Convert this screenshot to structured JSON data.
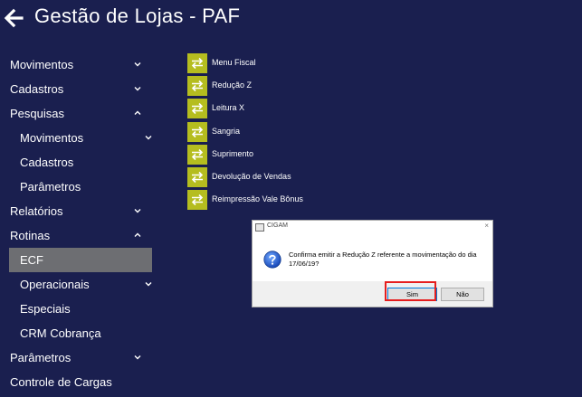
{
  "header": {
    "title": "Gestão de Lojas - PAF",
    "back_icon": "back-arrow-icon"
  },
  "sidebar": {
    "items": [
      {
        "label": "Movimentos",
        "level": 1,
        "chevron": "down"
      },
      {
        "label": "Cadastros",
        "level": 1,
        "chevron": "down"
      },
      {
        "label": "Pesquisas",
        "level": 1,
        "chevron": "up"
      },
      {
        "label": "Movimentos",
        "level": 2,
        "chevron": "down"
      },
      {
        "label": "Cadastros",
        "level": 2,
        "chevron": ""
      },
      {
        "label": "Parâmetros",
        "level": 2,
        "chevron": ""
      },
      {
        "label": "Relatórios",
        "level": 1,
        "chevron": "down"
      },
      {
        "label": "Rotinas",
        "level": 1,
        "chevron": "up"
      },
      {
        "label": "ECF",
        "level": 2,
        "chevron": "",
        "active": true
      },
      {
        "label": "Operacionais",
        "level": 2,
        "chevron": "down"
      },
      {
        "label": "Especiais",
        "level": 2,
        "chevron": ""
      },
      {
        "label": "CRM Cobrança",
        "level": 2,
        "chevron": ""
      },
      {
        "label": "Parâmetros",
        "level": 1,
        "chevron": "down"
      },
      {
        "label": "Controle de Cargas",
        "level": 1,
        "chevron": ""
      }
    ]
  },
  "actions": {
    "icon": "swap-arrows-icon",
    "items": [
      {
        "label": "Menu Fiscal"
      },
      {
        "label": "Redução Z"
      },
      {
        "label": "Leitura X"
      },
      {
        "label": "Sangria"
      },
      {
        "label": "Suprimento"
      },
      {
        "label": "Devolução de Vendas"
      },
      {
        "label": "Reimpressão Vale Bônus"
      }
    ]
  },
  "dialog": {
    "title": "CIGAM",
    "close": "×",
    "message": "Confirma emitir a Redução Z referente a movimentação do dia 17/06/19?",
    "icon": "question-icon",
    "yes_label": "Sim",
    "no_label": "Não"
  },
  "colors": {
    "background": "#1a1f4f",
    "active_item": "#6d6e72",
    "action_icon": "#b5bd1f",
    "highlight": "#e51e1e"
  }
}
